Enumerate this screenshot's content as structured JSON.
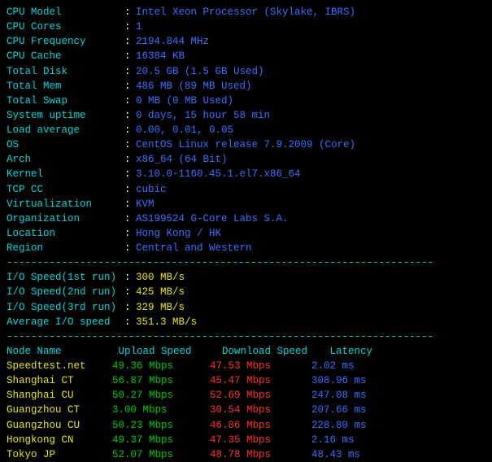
{
  "sys_labels": {
    "cpu_model": "CPU Model",
    "cpu_cores": "CPU Cores",
    "cpu_freq": "CPU Frequency",
    "cpu_cache": "CPU Cache",
    "total_disk": "Total Disk",
    "total_mem": "Total Mem",
    "total_swap": "Total Swap",
    "uptime": "System uptime",
    "load": "Load average",
    "os": "OS",
    "arch": "Arch",
    "kernel": "Kernel",
    "tcp_cc": "TCP CC",
    "virt": "Virtualization",
    "org": "Organization",
    "loc": "Location",
    "region": "Region"
  },
  "sys": {
    "cpu_model": "Intel Xeon Processor (Skylake, IBRS)",
    "cpu_cores": "1",
    "cpu_freq": "2194.844 MHz",
    "cpu_cache": "16384 KB",
    "total_disk": "20.5 GB (1.5 GB Used)",
    "total_mem": "486 MB (89 MB Used)",
    "total_swap": "0 MB (0 MB Used)",
    "uptime": "0 days, 15 hour 58 min",
    "load": "0.00, 0.01, 0.05",
    "os": "CentOS Linux release 7.9.2009 (Core)",
    "arch": "x86_64 (64 Bit)",
    "kernel": "3.10.0-1160.45.1.el7.x86_64",
    "tcp_cc": "cubic",
    "virt": "KVM",
    "org": "AS199524 G-Core Labs S.A.",
    "loc": "Hong Kong / HK",
    "region": "Central and Western"
  },
  "io_labels": {
    "r1": "I/O Speed(1st run)",
    "r2": "I/O Speed(2nd run)",
    "r3": "I/O Speed(3rd run)",
    "avg": "Average I/O speed"
  },
  "io": {
    "r1": "300 MB/s",
    "r2": "425 MB/s",
    "r3": "329 MB/s",
    "avg": "351.3 MB/s"
  },
  "cols": {
    "node": "Node Name",
    "up": "Upload Speed",
    "dn": "Download Speed",
    "lat": "Latency"
  },
  "speed": [
    {
      "name": "Speedtest.net",
      "up": "49.36 Mbps",
      "dn": "47.53 Mbps",
      "lat": "2.02 ms"
    },
    {
      "name": "Shanghai   CT",
      "up": "56.87 Mbps",
      "dn": "45.47 Mbps",
      "lat": "308.96 ms"
    },
    {
      "name": "Shanghai   CU",
      "up": "50.27 Mbps",
      "dn": "52.69 Mbps",
      "lat": "247.08 ms"
    },
    {
      "name": "Guangzhou  CT",
      "up": "3.00 Mbps",
      "dn": "30.54 Mbps",
      "lat": "207.66 ms"
    },
    {
      "name": "Guangzhou  CU",
      "up": "50.23 Mbps",
      "dn": "46.86 Mbps",
      "lat": "228.80 ms"
    },
    {
      "name": "Hongkong   CN",
      "up": "49.37 Mbps",
      "dn": "47.35 Mbps",
      "lat": "2.16 ms"
    },
    {
      "name": "Tokyo      JP",
      "up": "52.07 Mbps",
      "dn": "48.78 Mbps",
      "lat": "48.43 ms"
    }
  ],
  "divider": "----------------------------------------------------------------------"
}
